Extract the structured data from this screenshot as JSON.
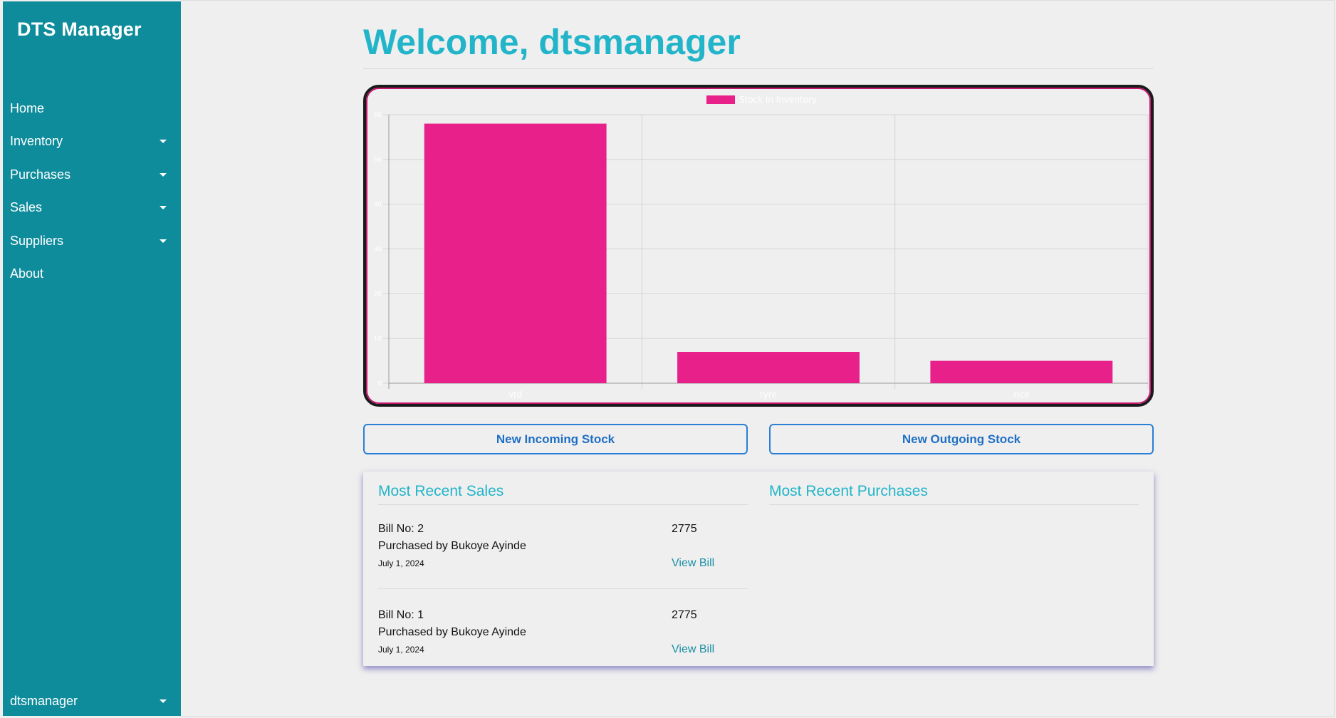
{
  "app": {
    "brand": "DTS Manager"
  },
  "sidebar": {
    "items": [
      {
        "label": "Home",
        "has_dropdown": false
      },
      {
        "label": "Inventory",
        "has_dropdown": true
      },
      {
        "label": "Purchases",
        "has_dropdown": true
      },
      {
        "label": "Sales",
        "has_dropdown": true
      },
      {
        "label": "Suppliers",
        "has_dropdown": true
      },
      {
        "label": "About",
        "has_dropdown": false
      }
    ],
    "user": "dtsmanager"
  },
  "header": {
    "title": "Welcome, dtsmanager"
  },
  "chart_data": {
    "type": "bar",
    "categories": [
      "vtd",
      "tyre",
      "rice"
    ],
    "series": [
      {
        "name": "Stock in Inventory",
        "values": [
          58,
          7,
          5
        ],
        "color": "#e8208a"
      }
    ],
    "ylim": [
      0,
      60
    ],
    "yticks": [
      "0",
      "10",
      "20",
      "30",
      "40",
      "50",
      "60"
    ],
    "grid": true,
    "legend": "top-center"
  },
  "actions": {
    "incoming": "New Incoming Stock",
    "outgoing": "New Outgoing Stock"
  },
  "recent_sales": {
    "title": "Most Recent Sales",
    "items": [
      {
        "bill": "Bill No: 2",
        "buyer": "Purchased by Bukoye Ayinde",
        "date": "July 1, 2024",
        "amount": "2775",
        "link": "View Bill"
      },
      {
        "bill": "Bill No: 1",
        "buyer": "Purchased by Bukoye Ayinde",
        "date": "July 1, 2024",
        "amount": "2775",
        "link": "View Bill"
      }
    ]
  },
  "recent_purchases": {
    "title": "Most Recent Purchases",
    "items": []
  },
  "colors": {
    "sidebar": "#0f8c9c",
    "accent": "#22b5c9",
    "bar": "#e8208a",
    "button": "#2a7fd6"
  }
}
